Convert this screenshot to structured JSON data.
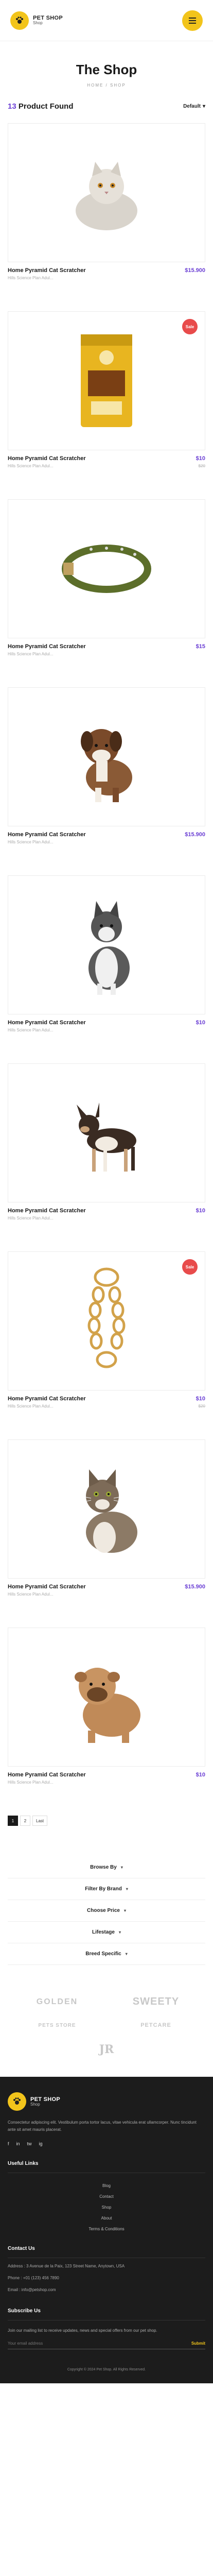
{
  "header": {
    "logo_title": "PET SHOP",
    "logo_subtitle": "Shop"
  },
  "page": {
    "title": "The Shop",
    "breadcrumb": "HOME / SHOP"
  },
  "toolbar": {
    "count": "13",
    "count_label": "Product Found",
    "sort_label": "Default"
  },
  "products": [
    {
      "name": "Home Pyramid Cat Scratcher",
      "desc": "Hills Science Plan Adul...",
      "price": "$15.900",
      "old_price": "",
      "badge": "",
      "image": "cat-persian"
    },
    {
      "name": "Home Pyramid Cat Scratcher",
      "desc": "Hills Science Plan Adul...",
      "price": "$10",
      "old_price": "$20",
      "badge": "Sale",
      "image": "cat-food-bag"
    },
    {
      "name": "Home Pyramid Cat Scratcher",
      "desc": "Hills Science Plan Adul...",
      "price": "$15",
      "old_price": "",
      "badge": "",
      "image": "dog-collar"
    },
    {
      "name": "Home Pyramid Cat Scratcher",
      "desc": "Hills Science Plan Adul...",
      "price": "$15.900",
      "old_price": "",
      "badge": "",
      "image": "puppy-boxer"
    },
    {
      "name": "Home Pyramid Cat Scratcher",
      "desc": "Hills Science Plan Adul...",
      "price": "$10",
      "old_price": "",
      "badge": "",
      "image": "husky"
    },
    {
      "name": "Home Pyramid Cat Scratcher",
      "desc": "Hills Science Plan Adul...",
      "price": "$10",
      "old_price": "",
      "badge": "",
      "image": "chihuahua"
    },
    {
      "name": "Home Pyramid Cat Scratcher",
      "desc": "Hills Science Plan Adul...",
      "price": "$10",
      "old_price": "$20",
      "badge": "Sale",
      "image": "chain-leash"
    },
    {
      "name": "Home Pyramid Cat Scratcher",
      "desc": "Hills Science Plan Adul...",
      "price": "$15.900",
      "old_price": "",
      "badge": "",
      "image": "tabby-cat"
    },
    {
      "name": "Home Pyramid Cat Scratcher",
      "desc": "Hills Science Plan Adul...",
      "price": "$10",
      "old_price": "",
      "badge": "",
      "image": "bulldog-puppy"
    }
  ],
  "pagination": {
    "pages": [
      "1",
      "2"
    ],
    "last_label": "Last",
    "current": "1"
  },
  "filters": [
    {
      "label": "Browse By"
    },
    {
      "label": "Filter By Brand"
    },
    {
      "label": "Choose Price"
    },
    {
      "label": "Lifestage"
    },
    {
      "label": "Breed Specific"
    }
  ],
  "brands": [
    "GOLDEN",
    "SWEETY",
    "PETS STORE",
    "PETCARE",
    "JR"
  ],
  "footer": {
    "logo_title": "PET SHOP",
    "logo_subtitle": "Shop",
    "description": "Consectetur adipiscing elit. Vestibulum porta tortor lacus, vitae vehicula erat ullamcorper. Nunc tincidunt ante sit amet mauris placerat.",
    "socials": [
      "f",
      "in",
      "tw",
      "ig"
    ],
    "useful_heading": "Useful Links",
    "useful_links": [
      "Blog",
      "Contact",
      "Shop",
      "About",
      "Terms & Conditions"
    ],
    "contact_heading": "Contact Us",
    "address": "Address : 3 Avenue de la Paix, 123 Street Name, Anytown, USA",
    "phone": "Phone : +01 (123) 456 7890",
    "email": "Email : info@petshop.com",
    "subscribe_heading": "Subscribe Us",
    "subscribe_desc": "Join our mailing list to receive updates, news and special offers from our pet shop.",
    "subscribe_placeholder": "Your email address",
    "subscribe_button": "Submit",
    "copyright": "Copyright © 2024 Pet Shop. All Rights Reserved."
  },
  "colors": {
    "accent": "#6b3fd4",
    "brand_yellow": "#f2c41b",
    "sale_red": "#e84b4b",
    "footer_bg": "#1c1c1c"
  }
}
